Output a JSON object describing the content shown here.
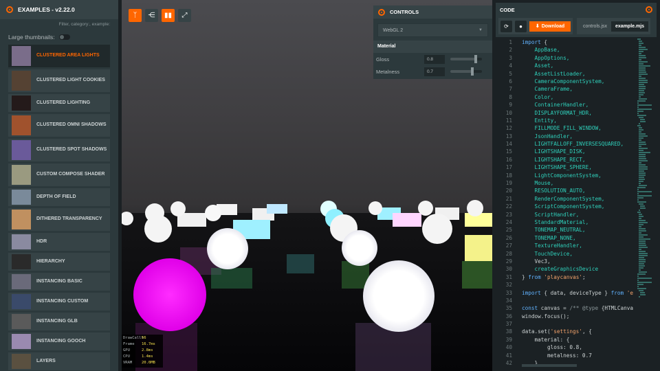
{
  "left_panel": {
    "title": "EXAMPLES - v2.22.0",
    "filter_placeholder": "Filter, category:, example:",
    "large_thumbnails_label": "Large thumbnails:",
    "large_thumbnails_on": false,
    "selected_index": 0,
    "examples": [
      {
        "label": "CLUSTERED AREA LIGHTS",
        "thumb": "#7a6d8a"
      },
      {
        "label": "CLUSTERED LIGHT COOKIES",
        "thumb": "#554233"
      },
      {
        "label": "CLUSTERED LIGHTING",
        "thumb": "#241a1a"
      },
      {
        "label": "CLUSTERED OMNI SHADOWS",
        "thumb": "#a0522d"
      },
      {
        "label": "CLUSTERED SPOT SHADOWS",
        "thumb": "#6a5a9a"
      },
      {
        "label": "CUSTOM COMPOSE SHADER",
        "thumb": "#9a9a80"
      },
      {
        "label": "DEPTH OF FIELD",
        "thumb": "#7a8a9a"
      },
      {
        "label": "DITHERED TRANSPARENCY",
        "thumb": "#c09060"
      },
      {
        "label": "HDR",
        "thumb": "#8a8aa0"
      },
      {
        "label": "HIERARCHY",
        "thumb": "#2a2a2a"
      },
      {
        "label": "INSTANCING BASIC",
        "thumb": "#6a6a7a"
      },
      {
        "label": "INSTANCING CUSTOM",
        "thumb": "#3a4a6a"
      },
      {
        "label": "INSTANCING GLB",
        "thumb": "#5a5a5a"
      },
      {
        "label": "INSTANCING GOOCH",
        "thumb": "#9a8ab0"
      },
      {
        "label": "LAYERS",
        "thumb": "#5a5040"
      }
    ]
  },
  "toolbar": {
    "buttons": [
      {
        "name": "playcanvas-logo-button",
        "icon": "playcanvas-logo-icon",
        "glyph": "ᛉ",
        "active": true
      },
      {
        "name": "share-button",
        "icon": "share-icon",
        "glyph": "⋲",
        "active": false
      },
      {
        "name": "stats-button",
        "icon": "bar-chart-icon",
        "glyph": "▮▮",
        "active": true
      },
      {
        "name": "fullscreen-button",
        "icon": "fullscreen-icon",
        "glyph": "⤢",
        "active": false
      }
    ]
  },
  "controls": {
    "title": "CONTROLS",
    "device_select": "WebGL 2",
    "section": "Material",
    "sliders": [
      {
        "label": "Gloss",
        "value": "0.8",
        "fraction": 0.8
      },
      {
        "label": "Metalness",
        "value": "0.7",
        "fraction": 0.7
      }
    ]
  },
  "stats": [
    {
      "label": "DrawCalls",
      "value": "56"
    },
    {
      "label": "Frame",
      "value": "16.7ms"
    },
    {
      "label": "GPU",
      "value": "2.8ms"
    },
    {
      "label": "CPU",
      "value": "1.4ms"
    },
    {
      "label": "VRAM",
      "value": "20.0MB"
    }
  ],
  "code_panel": {
    "title": "CODE",
    "download_label": "Download",
    "tabs": [
      "controls.jsx",
      "example.mjs"
    ],
    "active_tab": 1
  },
  "code_lines": [
    {
      "n": "1",
      "t": "import {"
    },
    {
      "n": "2",
      "t": "    AppBase,"
    },
    {
      "n": "3",
      "t": "    AppOptions,"
    },
    {
      "n": "4",
      "t": "    Asset,"
    },
    {
      "n": "5",
      "t": "    AssetListLoader,"
    },
    {
      "n": "6",
      "t": "    CameraComponentSystem,"
    },
    {
      "n": "7",
      "t": "    CameraFrame,"
    },
    {
      "n": "8",
      "t": "    Color,"
    },
    {
      "n": "9",
      "t": "    ContainerHandler,"
    },
    {
      "n": "10",
      "t": "    DISPLAYFORMAT_HDR,"
    },
    {
      "n": "11",
      "t": "    Entity,"
    },
    {
      "n": "12",
      "t": "    FILLMODE_FILL_WINDOW,"
    },
    {
      "n": "13",
      "t": "    JsonHandler,"
    },
    {
      "n": "14",
      "t": "    LIGHTFALLOFF_INVERSESQUARED,"
    },
    {
      "n": "15",
      "t": "    LIGHTSHAPE_DISK,"
    },
    {
      "n": "16",
      "t": "    LIGHTSHAPE_RECT,"
    },
    {
      "n": "17",
      "t": "    LIGHTSHAPE_SPHERE,"
    },
    {
      "n": "18",
      "t": "    LightComponentSystem,"
    },
    {
      "n": "19",
      "t": "    Mouse,"
    },
    {
      "n": "20",
      "t": "    RESOLUTION_AUTO,"
    },
    {
      "n": "21",
      "t": "    RenderComponentSystem,"
    },
    {
      "n": "22",
      "t": "    ScriptComponentSystem,"
    },
    {
      "n": "23",
      "t": "    ScriptHandler,"
    },
    {
      "n": "24",
      "t": "    StandardMaterial,"
    },
    {
      "n": "25",
      "t": "    TONEMAP_NEUTRAL,"
    },
    {
      "n": "26",
      "t": "    TONEMAP_NONE,"
    },
    {
      "n": "27",
      "t": "    TextureHandler,"
    },
    {
      "n": "28",
      "t": "    TouchDevice,"
    },
    {
      "n": "29",
      "t": "    Vec3,"
    },
    {
      "n": "30",
      "t": "    createGraphicsDevice"
    },
    {
      "n": "31",
      "t": "} from 'playcanvas';"
    },
    {
      "n": "32",
      "t": ""
    },
    {
      "n": "33",
      "t": "import { data, deviceType } from 'e"
    },
    {
      "n": "34",
      "t": ""
    },
    {
      "n": "35",
      "t": "const canvas = /** @type {HTMLCanva"
    },
    {
      "n": "36",
      "t": "window.focus();"
    },
    {
      "n": "37",
      "t": ""
    },
    {
      "n": "38",
      "t": "data.set('settings', {"
    },
    {
      "n": "39",
      "t": "    material: {"
    },
    {
      "n": "40",
      "t": "        gloss: 0.8,"
    },
    {
      "n": "41",
      "t": "        metalness: 0.7"
    },
    {
      "n": "42",
      "t": "    }"
    }
  ],
  "colors": {
    "accent": "#ff6600",
    "panel": "#2c393c",
    "panel_light": "#364346",
    "editor_bg": "#1b2124"
  }
}
